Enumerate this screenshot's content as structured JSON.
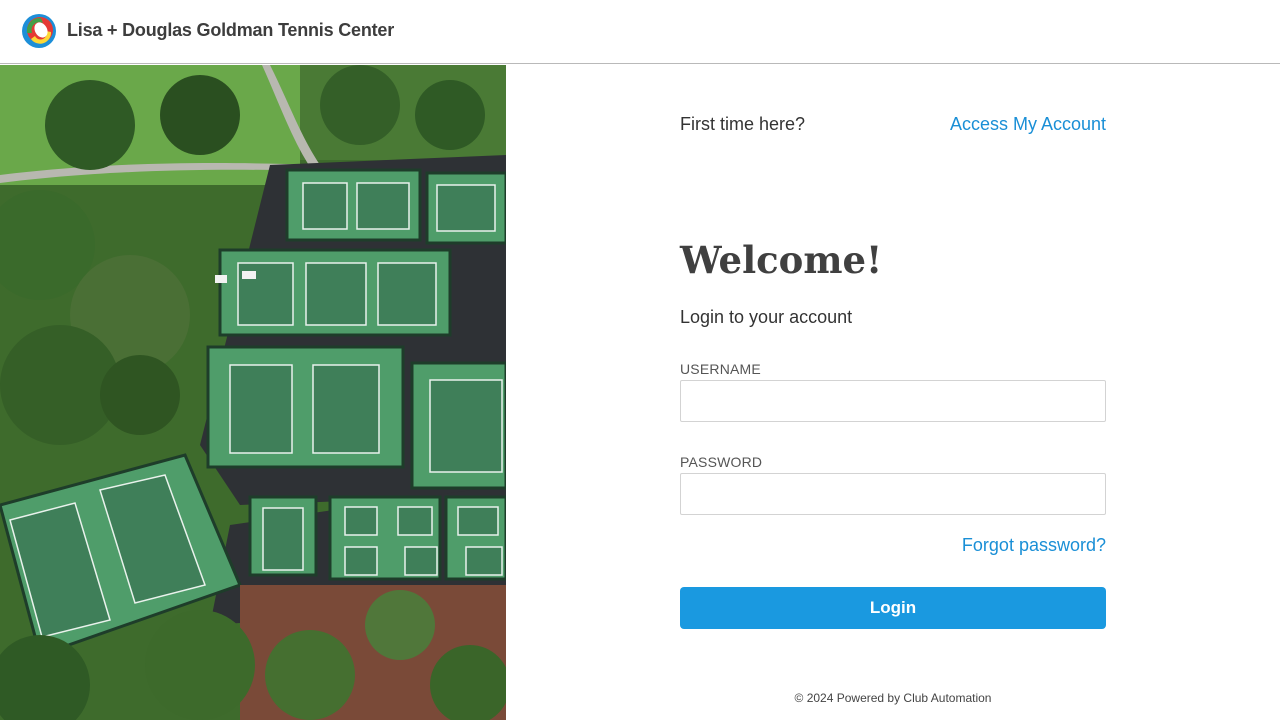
{
  "header": {
    "title": "Lisa + Douglas Goldman Tennis Center",
    "logo_icon": "club-logo-icon"
  },
  "hero": {
    "image": "aerial-tennis-courts-photo",
    "colors": {
      "grass": "#5f9a42",
      "court": "#4f9a68",
      "trees": "#2f5a25"
    }
  },
  "panel": {
    "first_time_text": "First time here?",
    "access_link": "Access My Account",
    "welcome_heading": "Welcome!",
    "subtitle": "Login to your account",
    "username": {
      "label": "USERNAME",
      "value": "",
      "placeholder": ""
    },
    "password": {
      "label": "PASSWORD",
      "value": "",
      "placeholder": ""
    },
    "forgot_link": "Forgot password?",
    "login_button": "Login"
  },
  "footer": {
    "text": "© 2024 Powered by Club Automation"
  },
  "colors": {
    "link": "#1a8fd6",
    "primary_button": "#1a99e0"
  }
}
